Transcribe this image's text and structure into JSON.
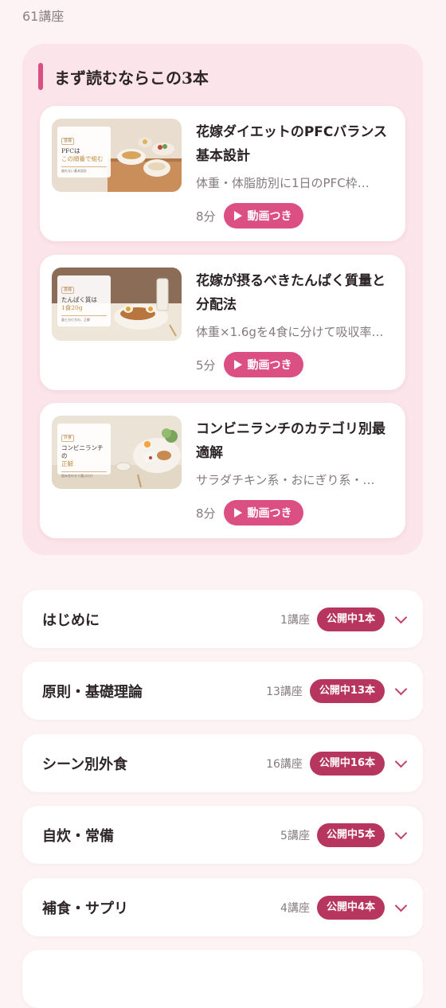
{
  "lesson_count": "61講座",
  "featured": {
    "title": "まず読むならこの3本",
    "cards": [
      {
        "title": "花嫁ダイエットのPFCバランス基本設計",
        "description": "体重・体脂肪別に1日のPFC枠…",
        "duration": "8分",
        "video_label": "動画つき",
        "thumb": {
          "tag": "基礎",
          "main1": "PFCは",
          "main2_accent": "この順番で組む",
          "sub": "崩れない基本設計"
        }
      },
      {
        "title": "花嫁が摂るべきたんぱく質量と分配法",
        "description": "体重×1.6gを4食に分けて吸収率…",
        "duration": "5分",
        "video_label": "動画つき",
        "thumb": {
          "tag": "基礎",
          "main1": "たんぱく質は",
          "main2_accent": "1食20g",
          "sub": "量と分け方の、正解"
        }
      },
      {
        "title": "コンビニランチのカテゴリ別最適解",
        "description": "サラダチキン系・おにぎり系・…",
        "duration": "8分",
        "video_label": "動画つき",
        "thumb": {
          "tag": "外食",
          "main1": "コンビニランチの",
          "main2_accent": "正解",
          "sub": "組み合わせで選ぶだけ"
        }
      }
    ]
  },
  "sections": [
    {
      "name": "はじめに",
      "count": "1講座",
      "badge": "公開中1本"
    },
    {
      "name": "原則・基礎理論",
      "count": "13講座",
      "badge": "公開中13本"
    },
    {
      "name": "シーン別外食",
      "count": "16講座",
      "badge": "公開中16本"
    },
    {
      "name": "自炊・常備",
      "count": "5講座",
      "badge": "公開中5本"
    },
    {
      "name": "補食・サプリ",
      "count": "4講座",
      "badge": "公開中4本"
    }
  ],
  "colors": {
    "background": "#fdf3f4",
    "featured_panel": "#fbe4ea",
    "accent_pink": "#dc4f82",
    "badge_crimson": "#b7365f"
  },
  "icons": [
    "play-icon",
    "chevron-down-icon"
  ]
}
